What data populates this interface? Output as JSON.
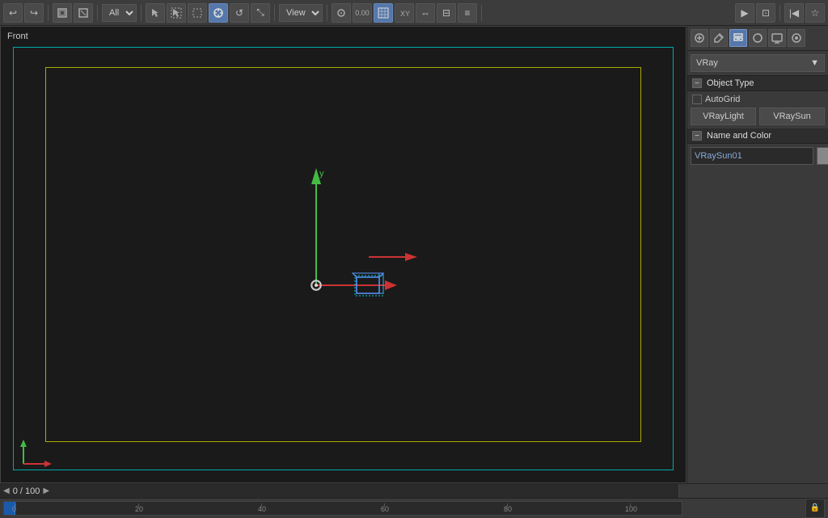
{
  "toolbar": {
    "dropdown_all": "All",
    "view_label": "View",
    "time_display": "0 / 100"
  },
  "viewport": {
    "label": "Front"
  },
  "right_panel": {
    "dropdown_label": "VRay",
    "icons": [
      "⊞",
      "⊡",
      "⋯",
      "◎",
      "▤",
      "◈",
      "⊕",
      "⊗",
      "☰",
      "⊞"
    ],
    "object_type": {
      "section_title": "Object Type",
      "autogrid_label": "AutoGrid",
      "btn1": "VRayLight",
      "btn2": "VRaySun"
    },
    "name_and_color": {
      "section_title": "Name and Color",
      "name_value": "VRaySun01",
      "color_hex": "#888888"
    }
  },
  "timeline": {
    "time_display": "0 / 100",
    "arrow_left": "◀",
    "arrow_right": "▶"
  },
  "ruler": {
    "ticks": [
      "0",
      "20",
      "40",
      "60",
      "80",
      "100"
    ]
  }
}
